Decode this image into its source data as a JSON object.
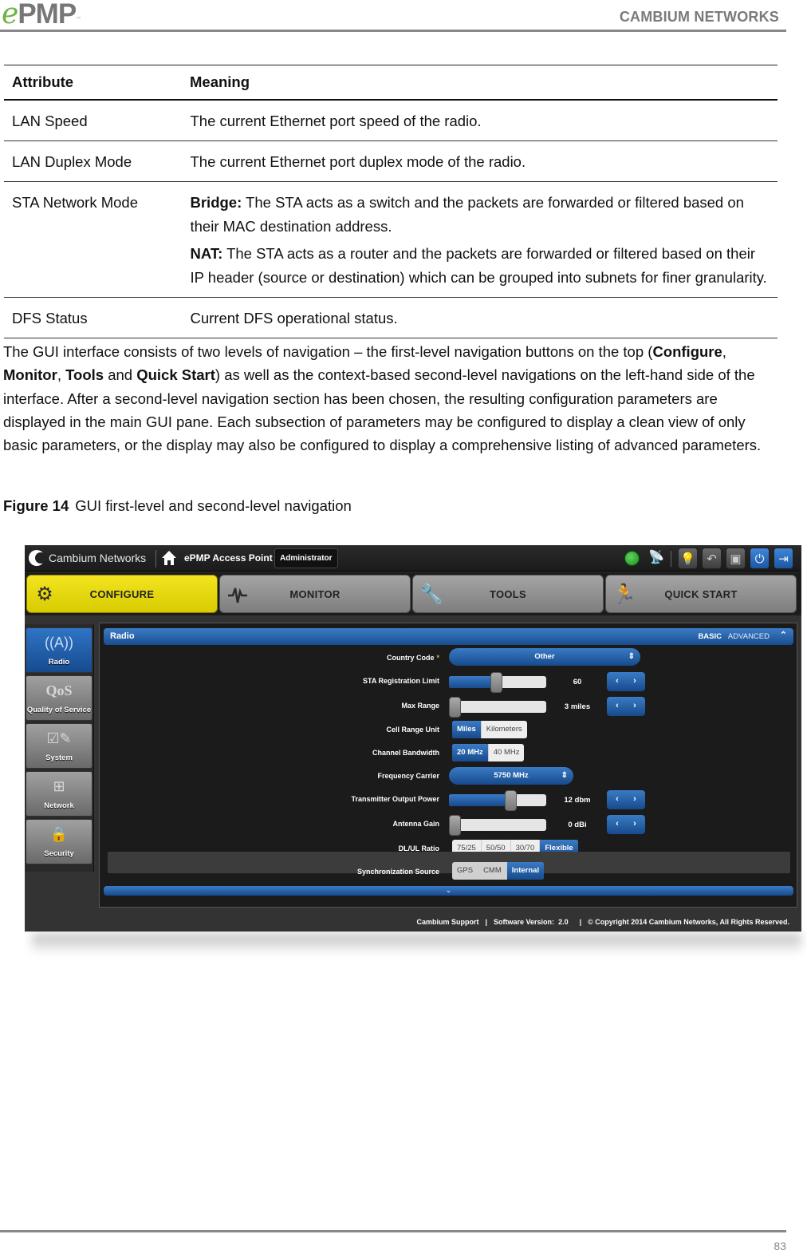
{
  "header": {
    "logo_e": "e",
    "logo_pmp": "PMP",
    "logo_tm": "™",
    "brand": "CAMBIUM NETWORKS"
  },
  "table": {
    "columns": [
      "Attribute",
      "Meaning"
    ],
    "rows": [
      {
        "attribute": "LAN Speed",
        "meaning": "The current Ethernet port speed of the radio."
      },
      {
        "attribute": "LAN Duplex Mode",
        "meaning": "The current Ethernet port duplex mode of the radio."
      },
      {
        "attribute": "STA Network Mode",
        "bridge_label": "Bridge:",
        "bridge_text": " The STA acts as a switch and the packets are forwarded or filtered based on their MAC destination address.",
        "nat_label": "NAT:",
        "nat_text": " The STA acts as a router and the packets are forwarded or filtered based on their IP header (source or destination) which can be grouped into subnets for finer granularity."
      },
      {
        "attribute": "DFS Status",
        "meaning": "Current DFS operational status."
      }
    ]
  },
  "paragraph": {
    "p1": "The GUI interface consists of two levels of navigation – the first-level navigation buttons on the top (",
    "b1": "Configure",
    "s1": ", ",
    "b2": "Monitor",
    "s2": ", ",
    "b3": "Tools",
    "s3": " and ",
    "b4": "Quick Start",
    "p2": ") as well as the context-based second-level navigations on the left-hand side of the interface. After a second-level navigation section has been chosen, the resulting configuration parameters are displayed in the main GUI pane.  Each subsection of parameters may be configured to display a clean view of only basic parameters, or the display may also be configured to display a comprehensive listing of advanced parameters."
  },
  "caption": {
    "label": "Figure 14",
    "text": "GUI first-level and second-level navigation"
  },
  "gui": {
    "topbar": {
      "brand": "Cambium Networks",
      "device": "ePMP Access Point",
      "role": "Administrator",
      "icons": [
        "globe-icon",
        "satellite-icon",
        "lightbulb-icon",
        "undo-icon",
        "save-icon",
        "power-icon",
        "logout-icon"
      ]
    },
    "nav": [
      {
        "label": "CONFIGURE",
        "icon": "gear-icon",
        "active": true
      },
      {
        "label": "MONITOR",
        "icon": "pulse-icon",
        "active": false
      },
      {
        "label": "TOOLS",
        "icon": "wrench-icon",
        "active": false
      },
      {
        "label": "QUICK START",
        "icon": "running-man-icon",
        "active": false
      }
    ],
    "sidebar": [
      {
        "label": "Radio",
        "icon": "radio-tower-icon",
        "glyph": "((A))",
        "active": true
      },
      {
        "label": "Quality of Service",
        "icon": "qos-icon",
        "glyph": "QoS",
        "active": false
      },
      {
        "label": "System",
        "icon": "system-edit-icon",
        "glyph": "☑✎",
        "active": false
      },
      {
        "label": "Network",
        "icon": "network-icon",
        "glyph": "⊞",
        "active": false
      },
      {
        "label": "Security",
        "icon": "lock-icon",
        "glyph": "🔒",
        "active": false
      }
    ],
    "section": {
      "title": "Radio",
      "mode_basic": "BASIC",
      "mode_advanced": "ADVANCED",
      "expand_glyph": "⌄"
    },
    "fields": {
      "country_code": {
        "label": "Country Code",
        "required_mark": "*",
        "value": "Other"
      },
      "sta_limit": {
        "label": "STA Registration Limit",
        "value": "60",
        "fraction": 0.48
      },
      "max_range": {
        "label": "Max Range",
        "value": "3 miles",
        "fraction": 0.02
      },
      "cell_range_unit": {
        "label": "Cell Range Unit",
        "options": [
          "Miles",
          "Kilometers"
        ],
        "selected": "Miles"
      },
      "channel_bandwidth": {
        "label": "Channel Bandwidth",
        "options": [
          "20 MHz",
          "40 MHz"
        ],
        "selected": "20 MHz"
      },
      "frequency_carrier": {
        "label": "Frequency Carrier",
        "value": "5750 MHz"
      },
      "tx_power": {
        "label": "Transmitter Output Power",
        "value": "12 dbm",
        "fraction": 0.63
      },
      "antenna_gain": {
        "label": "Antenna Gain",
        "value": "0 dBi",
        "fraction": 0.0
      },
      "dl_ul_ratio": {
        "label": "DL/UL Ratio",
        "options": [
          "75/25",
          "50/50",
          "30/70",
          "Flexible"
        ],
        "selected": "Flexible"
      },
      "sync_source": {
        "label": "Synchronization Source",
        "options": [
          "GPS",
          "CMM",
          "Internal"
        ],
        "selected": "Internal"
      }
    },
    "footer": {
      "support": "Cambium Support",
      "version_label": "Software Version:",
      "version": "2.0",
      "copyright": "© Copyright 2014 Cambium Networks, All Rights Reserved."
    }
  },
  "page_footer": {
    "page_number": "83"
  }
}
